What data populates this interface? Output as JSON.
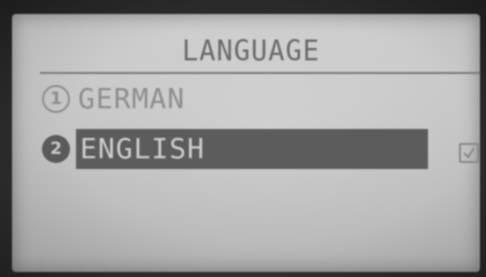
{
  "screen": {
    "title": "LANGUAGE",
    "items": [
      {
        "number": "1",
        "label": "GERMAN",
        "selected": false,
        "checked": false
      },
      {
        "number": "2",
        "label": "ENGLISH",
        "selected": true,
        "checked": true
      }
    ]
  },
  "icons": {
    "check": "checkbox-checked-icon"
  },
  "colors": {
    "lcd_background": "#c4c4c4",
    "highlight": "#5c5c5c",
    "text_dim": "#8e8e8e",
    "text_inverse": "#cdcdcd"
  }
}
